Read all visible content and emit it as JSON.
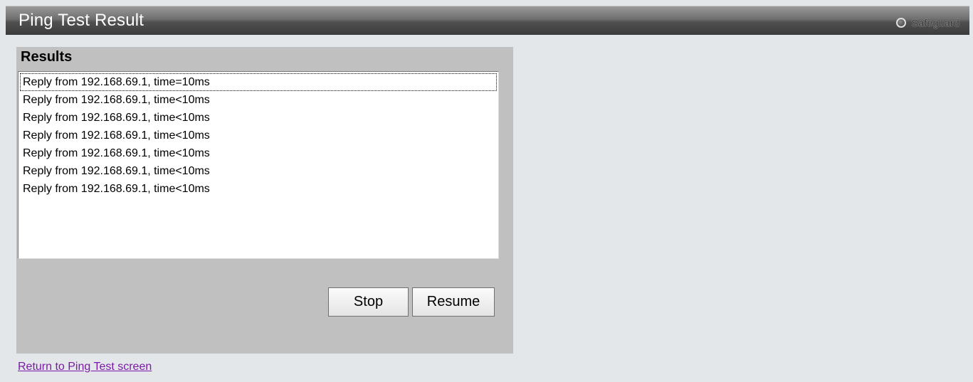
{
  "header": {
    "title": "Ping Test Result",
    "safeguard_label": "Safeguard",
    "safeguard_icon": "status-circle-icon"
  },
  "results": {
    "heading": "Results",
    "lines": [
      "Reply from 192.168.69.1, time=10ms",
      "Reply from 192.168.69.1, time<10ms",
      "Reply from 192.168.69.1, time<10ms",
      "Reply from 192.168.69.1, time<10ms",
      "Reply from 192.168.69.1, time<10ms",
      "Reply from 192.168.69.1, time<10ms",
      "Reply from 192.168.69.1, time<10ms"
    ]
  },
  "buttons": {
    "stop_label": "Stop",
    "resume_label": "Resume"
  },
  "footer": {
    "return_link": "Return to Ping Test screen"
  },
  "colors": {
    "background": "#e3e7ea",
    "panel": "#c0c0c0",
    "link": "#7b1aa6"
  }
}
